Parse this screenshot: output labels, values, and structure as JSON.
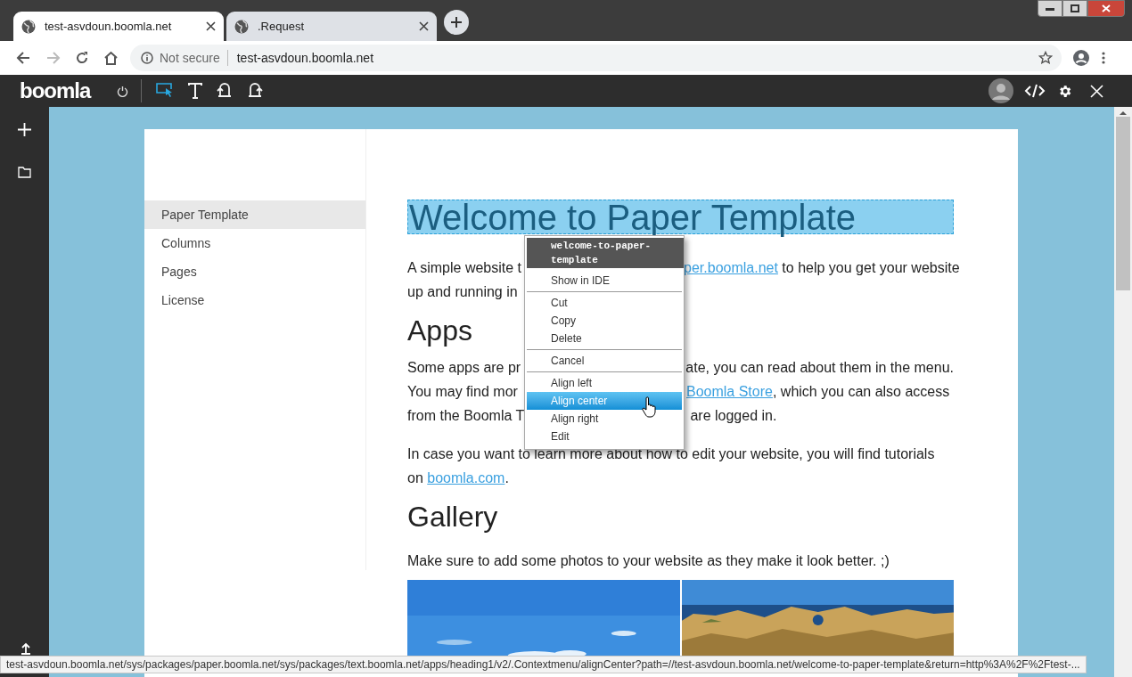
{
  "browser": {
    "tabs": [
      {
        "title": "test-asvdoun.boomla.net",
        "selected": true
      },
      {
        "title": ".Request",
        "selected": false
      }
    ],
    "address_bar": {
      "security": "Not secure",
      "url": "test-asvdoun.boomla.net"
    }
  },
  "editor_toolbar": {
    "logo": "boomla",
    "tools": [
      {
        "kind": "select",
        "selected": true
      },
      {
        "kind": "text",
        "selected": false
      },
      {
        "kind": "undo",
        "selected": false
      },
      {
        "kind": "redo",
        "selected": false
      }
    ]
  },
  "page": {
    "nav": [
      {
        "label": "Paper Template",
        "selected": true
      },
      {
        "label": "Columns",
        "selected": false
      },
      {
        "label": "Pages",
        "selected": false
      },
      {
        "label": "License",
        "selected": false
      }
    ],
    "blocks": [
      {
        "kind": "heading1",
        "text": "Welcome to Paper Template",
        "selected": true
      },
      {
        "kind": "split",
        "lines": [
          {
            "left": [
              {
                "text": "A simple website t"
              }
            ],
            "right": [
              {
                "text": "per.boomla.net",
                "link": true
              },
              {
                "text": " to help you get your website"
              }
            ]
          },
          {
            "left": [
              {
                "text": "up and running in"
              }
            ]
          }
        ]
      },
      {
        "kind": "heading2",
        "text": "Apps"
      },
      {
        "kind": "split",
        "lines": [
          {
            "left": [
              {
                "text": "Some apps are pr"
              }
            ],
            "right": [
              {
                "text": "ate, you can read about them in the menu."
              }
            ]
          },
          {
            "left": [
              {
                "text": "You may find mor"
              }
            ],
            "right": [
              {
                "text": "Boomla Store",
                "link": true
              },
              {
                "text": ", which you can also access"
              }
            ]
          },
          {
            "left": [
              {
                "text": "from the Boomla T"
              }
            ],
            "right": [
              {
                "text": " are logged in."
              }
            ]
          }
        ]
      },
      {
        "kind": "paragraph",
        "segments": [
          {
            "text": "In case you want to learn more about how to edit your website, you will find tutorials on "
          },
          {
            "text": "boomla.com",
            "link": true
          },
          {
            "text": "."
          }
        ]
      },
      {
        "kind": "heading2",
        "text": "Gallery"
      },
      {
        "kind": "paragraph",
        "segments": [
          {
            "text": "Make sure to add some photos to your website as they make it look better. ;)"
          }
        ]
      },
      {
        "kind": "gallery"
      }
    ]
  },
  "context_menu": {
    "title": "welcome-to-paper-template",
    "groups": [
      [
        {
          "label": "Show in IDE",
          "selected": false
        }
      ],
      [
        {
          "label": "Cut",
          "selected": false
        },
        {
          "label": "Copy",
          "selected": false
        },
        {
          "label": "Delete",
          "selected": false
        }
      ],
      [
        {
          "label": "Cancel",
          "selected": false
        }
      ],
      [
        {
          "label": "Align left",
          "selected": false
        },
        {
          "label": "Align center",
          "selected": true
        },
        {
          "label": "Align right",
          "selected": false
        },
        {
          "label": "Edit",
          "selected": false
        }
      ]
    ]
  },
  "status_bar": {
    "url": "test-asvdoun.boomla.net/sys/packages/paper.boomla.net/sys/packages/text.boomla.net/apps/heading1/v2/.Contextmenu/alignCenter?path=//test-asvdoun.boomla.net/welcome-to-paper-template&return=http%3A%2F%2Ftest-..."
  }
}
